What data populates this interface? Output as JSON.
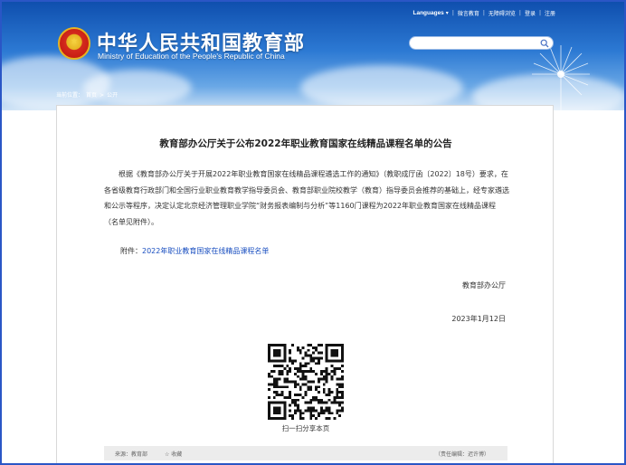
{
  "header": {
    "site_title": "中华人民共和国教育部",
    "site_subtitle": "Ministry of Education of the People's Republic of China",
    "topnav": [
      "Languages",
      "微言教育",
      "无障碍浏览",
      "登录",
      "注册"
    ],
    "search_placeholder": ""
  },
  "breadcrumb": {
    "items": [
      "当前位置：",
      "首页",
      ">",
      "公开"
    ]
  },
  "article": {
    "title": "教育部办公厅关于公布2022年职业教育国家在线精品课程名单的公告",
    "body": "根据《教育部办公厅关于开展2022年职业教育国家在线精品课程遴选工作的通知》（教职成厅函〔2022〕18号）要求，在各省级教育行政部门和全国行业职业教育教学指导委员会、教育部职业院校教学（教育）指导委员会推荐的基础上，经专家遴选和公示等程序，决定认定北京经济管理职业学院“财务报表编制与分析”等1160门课程为2022年职业教育国家在线精品课程（名单见附件）。",
    "attach_label": "附件：",
    "attach_link": "2022年职业教育国家在线精品课程名单",
    "sign_org": "教育部办公厅",
    "sign_date": "2023年1月12日",
    "qr_caption": "扫一扫分享本页"
  },
  "footer": {
    "source": "来源：教育部",
    "favorite": "☆ 收藏",
    "editor": "（责任编辑：迟许博）"
  },
  "colors": {
    "accent": "#2a56c6",
    "link": "#1a4fc0",
    "header_top": "#0f4fae"
  }
}
